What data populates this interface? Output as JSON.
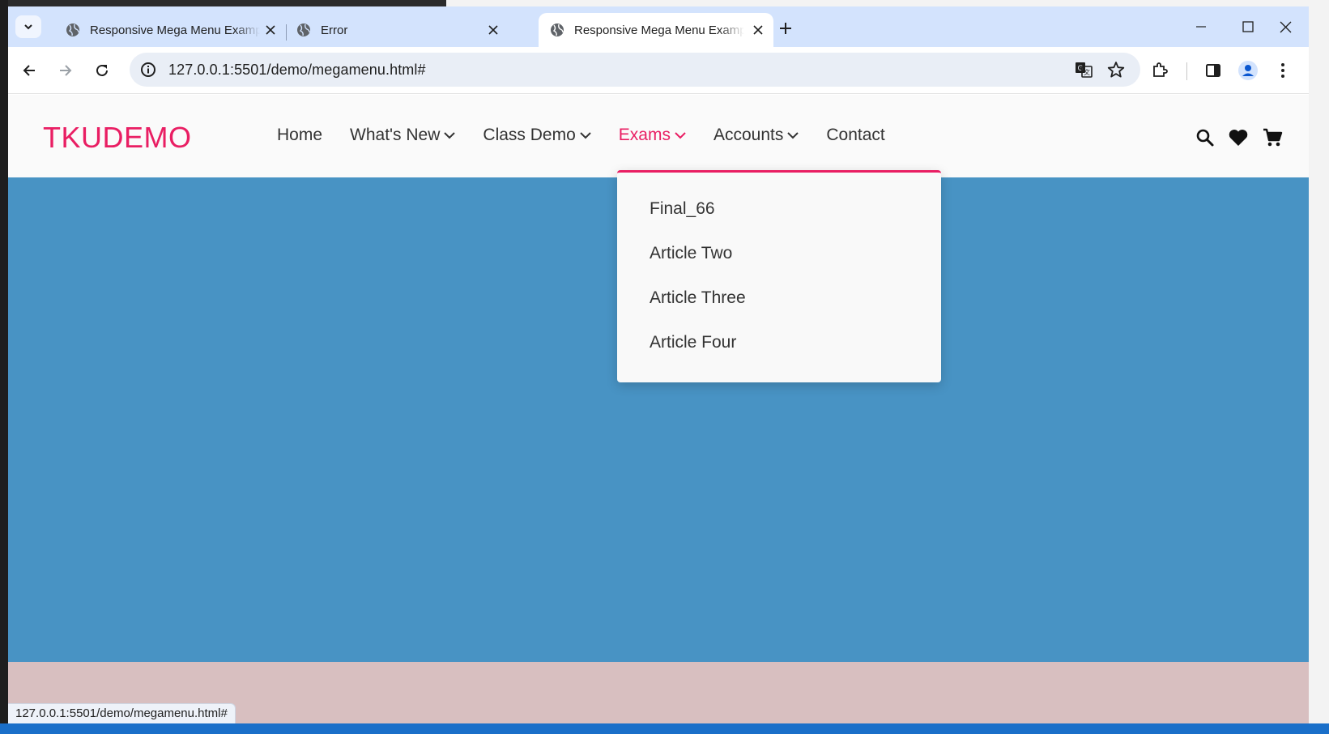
{
  "browser": {
    "tabs": [
      {
        "title": "Responsive Mega Menu Example",
        "active": false
      },
      {
        "title": "Error",
        "active": false
      },
      {
        "title": "Responsive Mega Menu Example",
        "active": true
      }
    ],
    "address": "127.0.0.1:5501/demo/megamenu.html#",
    "status_url": "127.0.0.1:5501/demo/megamenu.html#"
  },
  "site": {
    "logo": "TKUDEMO",
    "nav": [
      {
        "label": "Home",
        "has_dropdown": false,
        "active": false
      },
      {
        "label": "What's New",
        "has_dropdown": true,
        "active": false
      },
      {
        "label": "Class Demo",
        "has_dropdown": true,
        "active": false
      },
      {
        "label": "Exams",
        "has_dropdown": true,
        "active": true
      },
      {
        "label": "Accounts",
        "has_dropdown": true,
        "active": false
      },
      {
        "label": "Contact",
        "has_dropdown": false,
        "active": false
      }
    ],
    "header_icons": [
      "search-icon",
      "heart-icon",
      "cart-icon"
    ],
    "exams_menu": [
      "Final_66",
      "Article Two",
      "Article Three",
      "Article Four"
    ]
  },
  "colors": {
    "accent": "#e91e63",
    "hero": "#4893c4",
    "footer": "#d8bfc0",
    "tabstrip": "#d3e3fd"
  }
}
